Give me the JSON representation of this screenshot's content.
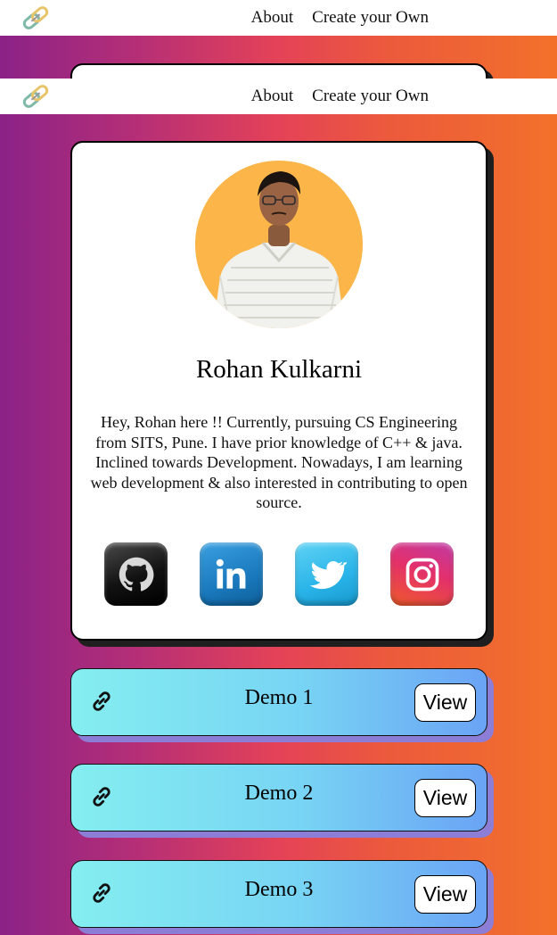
{
  "nav": {
    "about": "About",
    "create": "Create your Own"
  },
  "profile": {
    "name": "Rohan Kulkarni",
    "bio": "Hey, Rohan here !! Currently, pursuing CS Engineering from SITS, Pune. I have prior knowledge of C++ & java. Inclined towards Development. Nowadays, I am learning web development & also interested in contributing to open source.",
    "avatar_bg": "#fbb548"
  },
  "socials": [
    {
      "icon": "github-icon",
      "color": "#111111"
    },
    {
      "icon": "linkedin-icon",
      "color": "#1a79bd"
    },
    {
      "icon": "twitter-icon",
      "color": "#29b3e8"
    },
    {
      "icon": "instagram-icon",
      "color": "#e3306c"
    }
  ],
  "links": [
    {
      "title": "Demo 1",
      "button": "View"
    },
    {
      "title": "Demo 2",
      "button": "View"
    },
    {
      "title": "Demo 3",
      "button": "View"
    }
  ],
  "colors": {
    "background_start": "#8b2287",
    "background_mid": "#e44257",
    "background_end": "#f2712a",
    "link_card_start": "#84eef0",
    "link_card_end": "#6aa3f5",
    "link_shadow": "#8c7ed6"
  }
}
